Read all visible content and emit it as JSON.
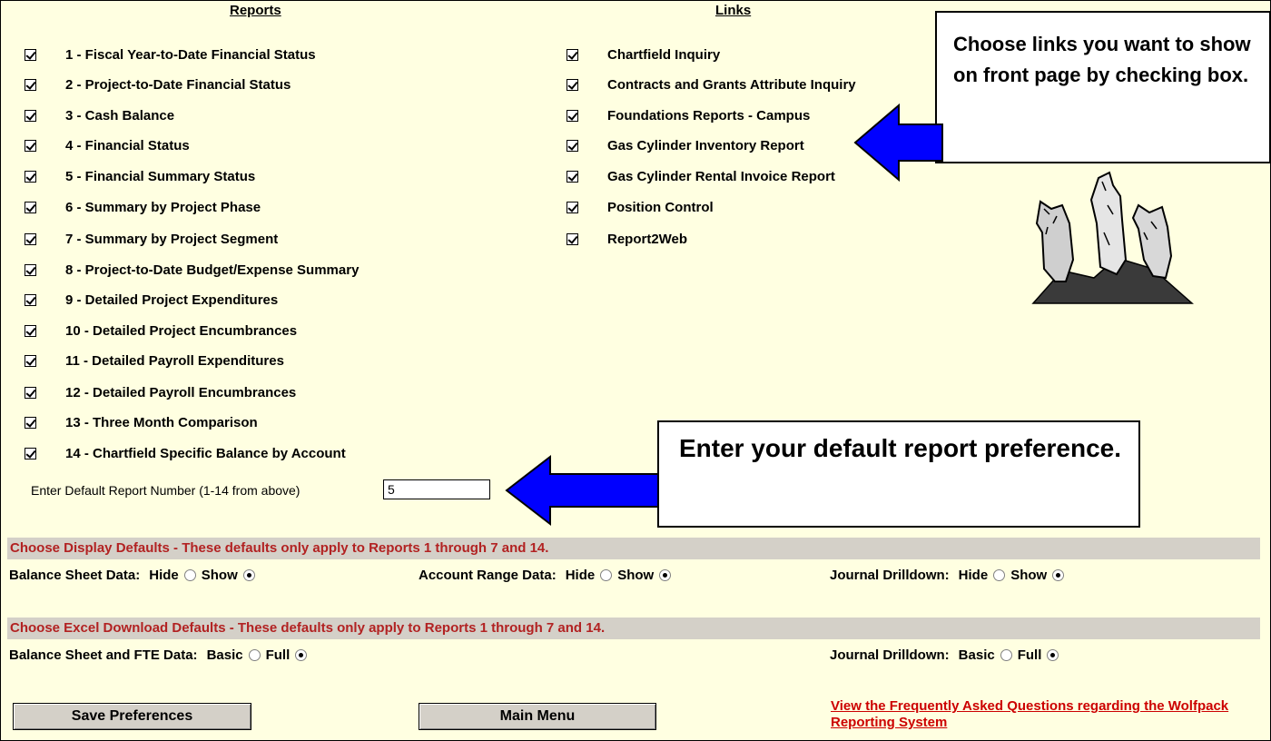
{
  "reports": {
    "header": "Reports",
    "items": [
      {
        "label": "1 - Fiscal Year-to-Date Financial Status",
        "checked": true
      },
      {
        "label": "2 - Project-to-Date Financial Status",
        "checked": true
      },
      {
        "label": "3 - Cash Balance",
        "checked": true
      },
      {
        "label": "4 - Financial Status",
        "checked": true
      },
      {
        "label": "5 - Financial Summary Status",
        "checked": true
      },
      {
        "label": "6 - Summary by Project Phase",
        "checked": true
      },
      {
        "label": "7 - Summary by Project Segment",
        "checked": true
      },
      {
        "label": "8 - Project-to-Date Budget/Expense Summary",
        "checked": true
      },
      {
        "label": "9 - Detailed Project Expenditures",
        "checked": true
      },
      {
        "label": "10 - Detailed Project Encumbrances",
        "checked": true
      },
      {
        "label": "11 - Detailed Payroll Expenditures",
        "checked": true
      },
      {
        "label": "12 - Detailed Payroll Encumbrances",
        "checked": true
      },
      {
        "label": "13 - Three Month Comparison",
        "checked": true
      },
      {
        "label": "14 - Chartfield Specific Balance by Account",
        "checked": true
      }
    ]
  },
  "links": {
    "header": "Links",
    "items": [
      {
        "label": "Chartfield Inquiry",
        "checked": true
      },
      {
        "label": "Contracts and Grants Attribute Inquiry",
        "checked": true
      },
      {
        "label": "Foundations Reports - Campus",
        "checked": true
      },
      {
        "label": "Gas Cylinder Inventory Report",
        "checked": true
      },
      {
        "label": "Gas Cylinder Rental Invoice Report",
        "checked": true
      },
      {
        "label": "Position Control",
        "checked": true
      },
      {
        "label": "Report2Web",
        "checked": true
      }
    ]
  },
  "callouts": {
    "links_note": "Choose links you want to show on front page by checking box.",
    "default_note": "Enter your default report preference."
  },
  "default_report": {
    "label": "Enter Default Report Number (1-14 from above)",
    "value": "5"
  },
  "display_defaults": {
    "title": "Choose Display Defaults - These defaults only apply to Reports 1 through 7 and 14.",
    "balance_sheet": {
      "label": "Balance Sheet Data:",
      "option1": "Hide",
      "option2": "Show",
      "selected": "Show"
    },
    "account_range": {
      "label": "Account Range Data:",
      "option1": "Hide",
      "option2": "Show",
      "selected": "Show"
    },
    "journal": {
      "label": "Journal Drilldown:",
      "option1": "Hide",
      "option2": "Show",
      "selected": "Show"
    }
  },
  "excel_defaults": {
    "title": "Choose Excel Download Defaults - These defaults only apply to Reports 1 through 7 and 14.",
    "balance_sheet_fte": {
      "label": "Balance Sheet and FTE Data:",
      "option1": "Basic",
      "option2": "Full",
      "selected": "Full"
    },
    "journal": {
      "label": "Journal Drilldown:",
      "option1": "Basic",
      "option2": "Full",
      "selected": "Full"
    }
  },
  "buttons": {
    "save": "Save Preferences",
    "main_menu": "Main Menu"
  },
  "faq_link": "View the Frequently Asked Questions regarding the Wolfpack Reporting System",
  "colors": {
    "background": "#FFFFE1",
    "section_bar": "#D4D0C8",
    "section_text": "#B22222",
    "link": "#CC0000",
    "arrow": "#0000FF"
  }
}
